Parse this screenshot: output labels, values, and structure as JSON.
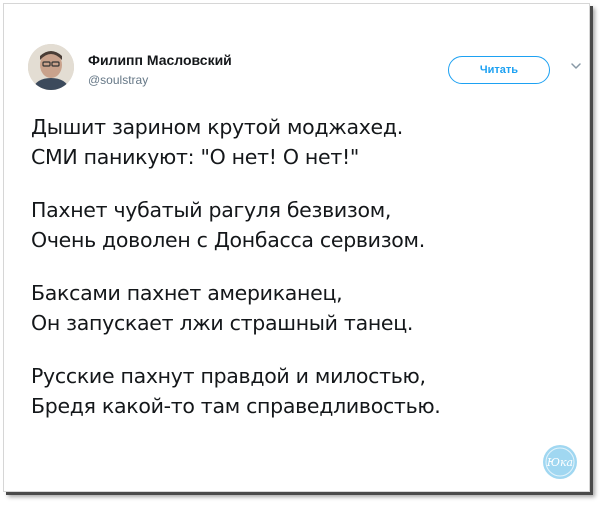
{
  "tweet": {
    "author_name": "Филипп Масловский",
    "author_handle": "@soulstray",
    "follow_label": "Читать",
    "icons": {
      "avatar": "user-avatar-photo",
      "caret": "chevron-down-icon",
      "watermark": "yuka-logo"
    },
    "stanzas": [
      {
        "lines": [
          "Дышит зарином крутой моджахед.",
          "СМИ паникуют: \"О нет! О нет!\""
        ]
      },
      {
        "lines": [
          "Пахнет чубатый рагуля безвизом,",
          "Очень доволен с Донбасса сервизом."
        ]
      },
      {
        "lines": [
          "Баксами пахнет американец,",
          "Он запускает лжи страшный танец."
        ]
      },
      {
        "lines": [
          "Русские пахнут правдой и милостью,",
          "Бредя какой-то там справедливостью."
        ]
      }
    ],
    "watermark_text": "Юка",
    "colors": {
      "accent": "#1da1f2",
      "text": "#14171a",
      "muted": "#657786",
      "watermark": "#8fd0ee"
    }
  }
}
